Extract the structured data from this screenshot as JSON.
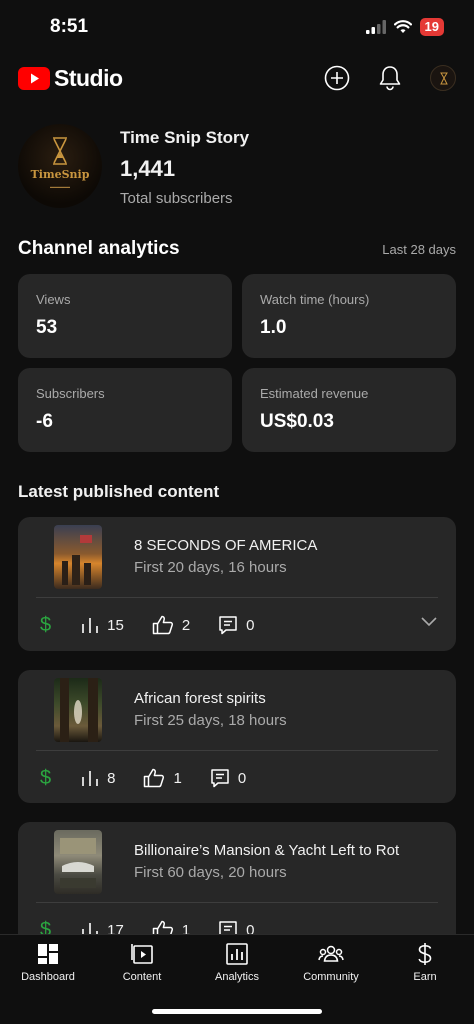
{
  "status_bar": {
    "time": "8:51",
    "battery": "19"
  },
  "header": {
    "logo_text": "Studio",
    "add_icon": "plus-circle-icon",
    "bell_icon": "bell-icon"
  },
  "channel": {
    "name": "Time Snip Story",
    "subscribers": "1,441",
    "subscribers_label": "Total subscribers",
    "logo_text": "TimeSnip"
  },
  "analytics": {
    "title": "Channel analytics",
    "range": "Last 28 days",
    "metrics": [
      {
        "label": "Views",
        "value": "53"
      },
      {
        "label": "Watch time (hours)",
        "value": "1.0"
      },
      {
        "label": "Subscribers",
        "value": "-6"
      },
      {
        "label": "Estimated revenue",
        "value": "US$0.03"
      }
    ]
  },
  "latest": {
    "title": "Latest published content",
    "items": [
      {
        "title": "8 SECONDS OF AMERICA",
        "subtitle": "First 20 days, 16 hours",
        "views": "15",
        "likes": "2",
        "comments": "0"
      },
      {
        "title": "African forest spirits",
        "subtitle": "First 25 days, 18 hours",
        "views": "8",
        "likes": "1",
        "comments": "0"
      },
      {
        "title": "Billionaire’s Mansion & Yacht Left to Rot",
        "subtitle": "First 60 days, 20 hours",
        "views": "17",
        "likes": "1",
        "comments": "0"
      }
    ]
  },
  "nav": [
    {
      "label": "Dashboard",
      "icon": "dashboard-icon"
    },
    {
      "label": "Content",
      "icon": "content-icon"
    },
    {
      "label": "Analytics",
      "icon": "analytics-icon"
    },
    {
      "label": "Community",
      "icon": "community-icon"
    },
    {
      "label": "Earn",
      "icon": "earn-icon"
    }
  ],
  "colors": {
    "background": "#0f0f0f",
    "card": "#272727",
    "brand_red": "#ff0000",
    "money_green": "#2ba640"
  }
}
